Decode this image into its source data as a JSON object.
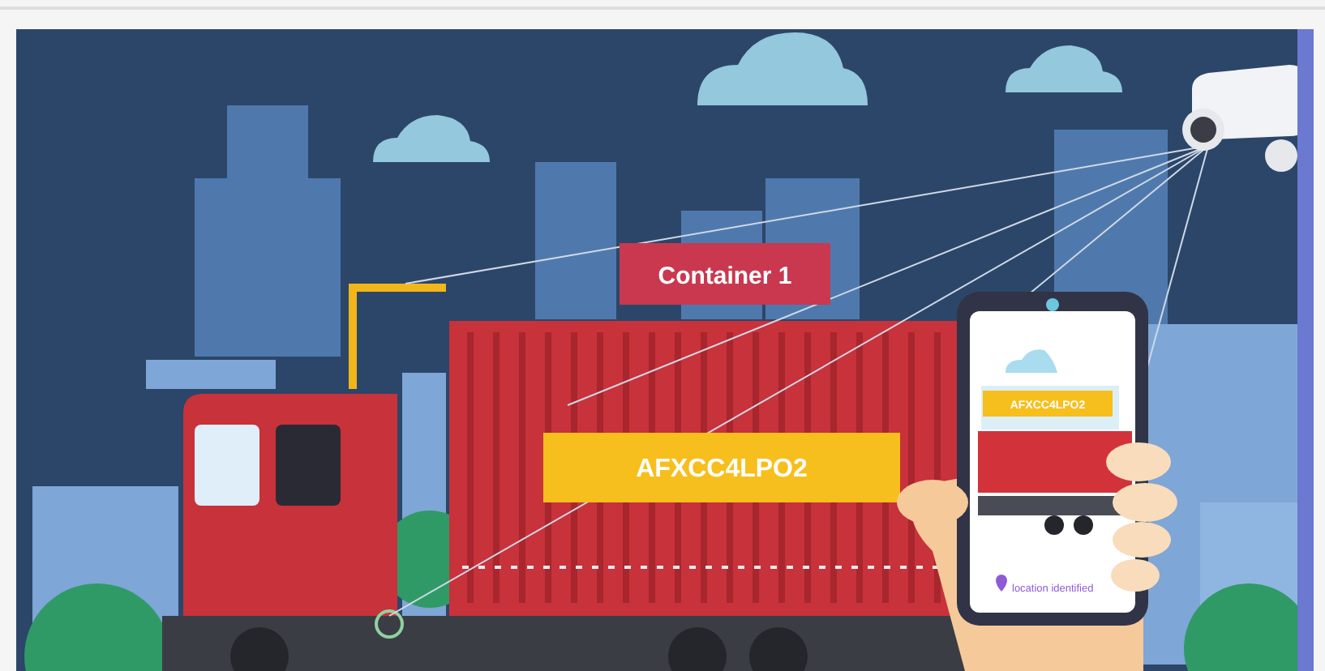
{
  "illustration": {
    "container_label": "Container 1",
    "container_code": "AFXCC4LPO2",
    "phone": {
      "code": "AFXCC4LPO2",
      "status": "location identified"
    }
  }
}
